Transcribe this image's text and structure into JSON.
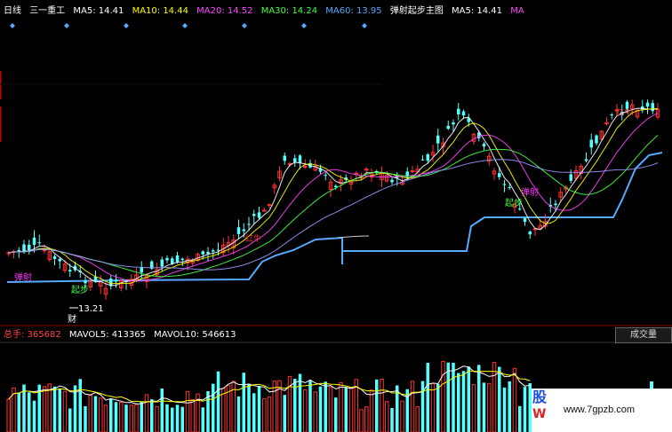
{
  "header": {
    "period": "日线",
    "stock_name": "三一重工",
    "ma_items": [
      {
        "label": "MA5: 14.41",
        "color": "#ffffff"
      },
      {
        "label": "MA10: 14.44",
        "color": "#ffff00"
      },
      {
        "label": "MA20: 14.52",
        "color": "#ff44ff"
      },
      {
        "label": "MA30: 14.24",
        "color": "#44ff44"
      },
      {
        "label": "MA60: 13.95",
        "color": "#55aaff"
      }
    ],
    "indicator_name": "弹射起步主图",
    "ma5_repeat": "MA5: 14.41",
    "ma_trunc": "MA"
  },
  "annotations": {
    "tanshe": "弹射",
    "qibu": "起步",
    "low_price": "13.21",
    "cai": "财",
    "hongniu": "红牛"
  },
  "volume": {
    "total_label": "总手: 365682",
    "mavol5": "MAVOL5: 413365",
    "mavol10": "MAVOL10: 546613",
    "button_label": "成交量"
  },
  "watermark": {
    "logo_top": "股",
    "logo_bottom": "W",
    "url": "www.7gpzb.com"
  },
  "colors": {
    "bg": "#000000",
    "up": "#ff3232",
    "down": "#54ffff",
    "support": "#55aaff",
    "diamond": "#55aaff",
    "axis_red": "#c00000"
  }
}
